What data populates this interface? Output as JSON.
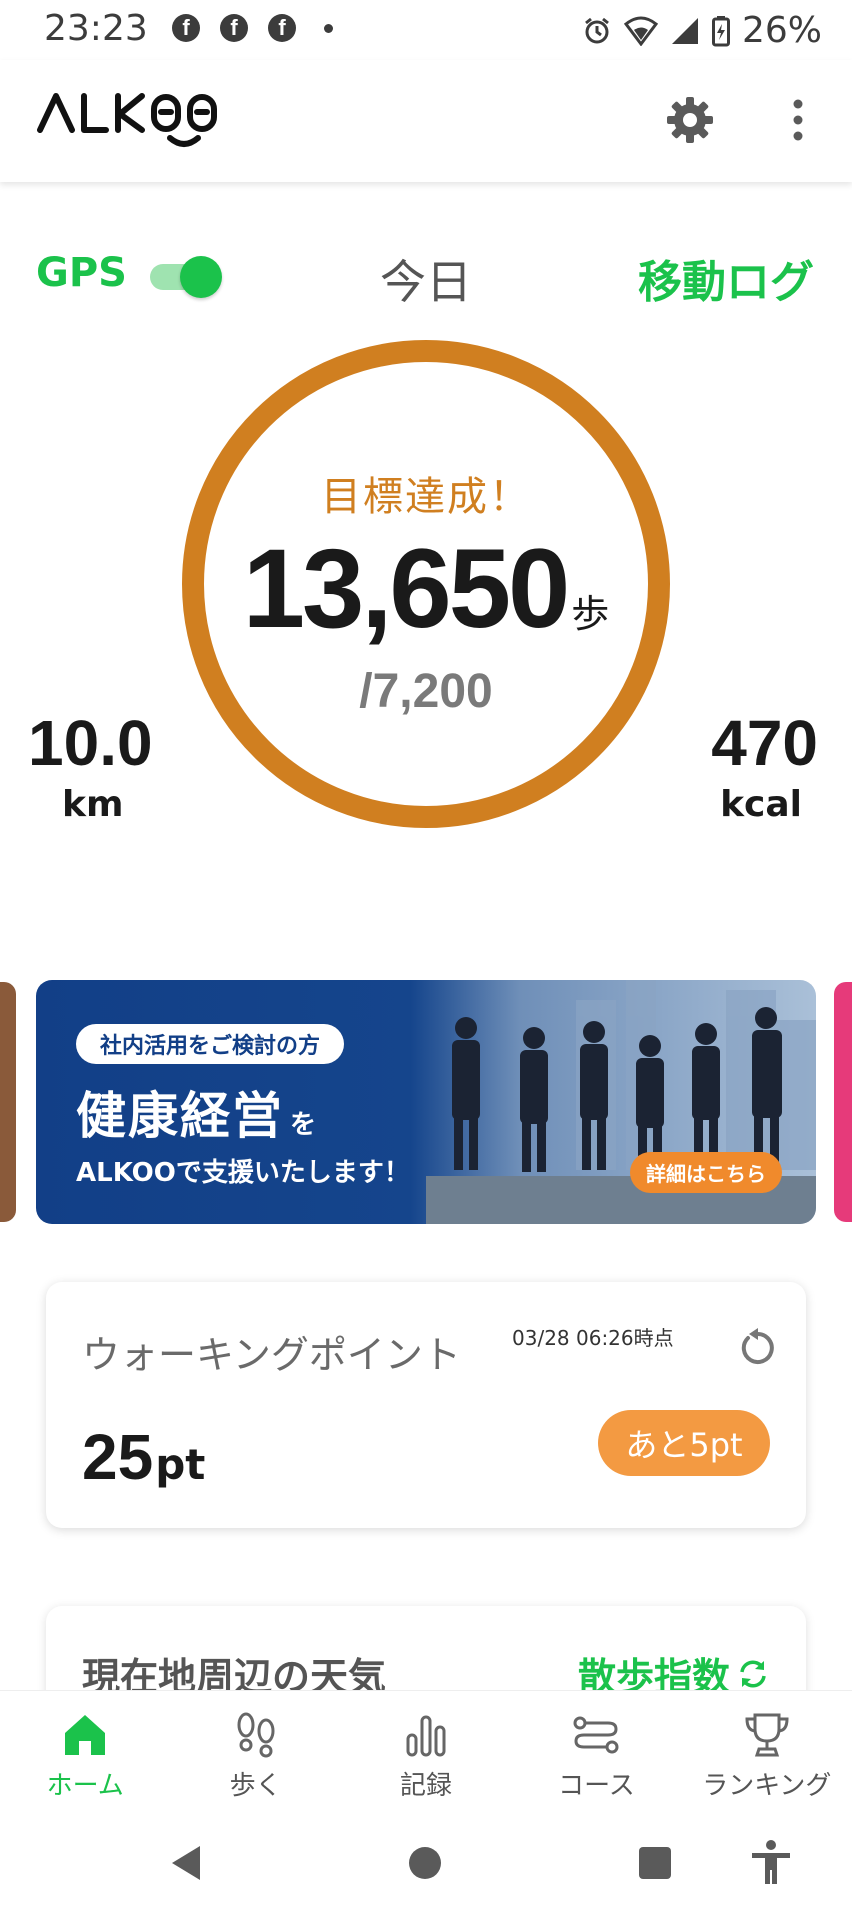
{
  "status_bar": {
    "time": "23:23",
    "notification_icons": [
      "facebook-icon",
      "facebook-icon",
      "facebook-icon"
    ],
    "battery_percent": "26%"
  },
  "app_bar": {
    "logo_text": "ALKOO",
    "icons": [
      "gear-icon",
      "more-vert-icon"
    ]
  },
  "summary": {
    "gps_label": "GPS",
    "gps_enabled": true,
    "period_label": "今日",
    "move_log_label": "移動ログ",
    "goal_message": "目標達成！",
    "steps": "13,650",
    "steps_unit": "歩",
    "steps_target": "/7,200",
    "distance_value": "10.0",
    "distance_unit": "km",
    "calories_value": "470",
    "calories_unit": "kcal",
    "ring_color": "#d07f20"
  },
  "banner": {
    "pill": "社内活用をご検討の方",
    "headline": "健康経営",
    "headline_suffix": "を",
    "subline": "ALKOOで支援いたします！",
    "cta": "詳細はこちら"
  },
  "points_card": {
    "title": "ウォーキングポイント",
    "timestamp": "03/28 06:26時点",
    "value": "25",
    "unit": "pt",
    "remaining": "あと5pt"
  },
  "weather_card": {
    "title": "現在地周辺の天気",
    "walk_index_label": "散歩指数"
  },
  "bottom_nav": {
    "items": [
      {
        "label": "ホーム",
        "icon": "home-icon",
        "active": true
      },
      {
        "label": "歩く",
        "icon": "footprints-icon",
        "active": false
      },
      {
        "label": "記録",
        "icon": "bar-chart-icon",
        "active": false
      },
      {
        "label": "コース",
        "icon": "route-icon",
        "active": false
      },
      {
        "label": "ランキング",
        "icon": "trophy-icon",
        "active": false
      }
    ]
  },
  "system_nav": [
    "back-icon",
    "home-circle-icon",
    "recents-icon",
    "accessibility-icon"
  ],
  "colors": {
    "accent_green": "#1bc24b",
    "goal_orange": "#d07f20",
    "points_orange": "#f39a42",
    "banner_blue": "#123f87"
  }
}
